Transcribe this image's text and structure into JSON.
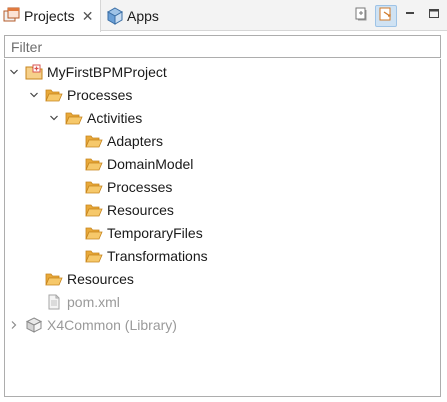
{
  "tabs": {
    "projects_label": "Projects",
    "apps_label": "Apps"
  },
  "filter": {
    "placeholder": "Filter"
  },
  "tree": {
    "project": "MyFirstBPMProject",
    "processes": "Processes",
    "activities": "Activities",
    "activity_children": [
      "Adapters",
      "DomainModel",
      "Processes",
      "Resources",
      "TemporaryFiles",
      "Transformations"
    ],
    "resources": "Resources",
    "pom": "pom.xml",
    "library": "X4Common (Library)"
  },
  "colors": {
    "folder": "#e8a93a",
    "folder_dark": "#c7851d",
    "project_red": "#d9534f",
    "muted_text": "#9a9a9a",
    "pressed_bg": "#cfe2f3"
  },
  "icons": {
    "projects_tab": "projects-icon",
    "apps_tab": "cube-icon",
    "collapse_all": "collapse-all-icon",
    "link_with_editor": "link-editor-icon",
    "minimize": "minimize-icon",
    "maximize": "maximize-icon",
    "folder": "open-folder-icon",
    "file": "file-icon",
    "library": "library-icon"
  }
}
